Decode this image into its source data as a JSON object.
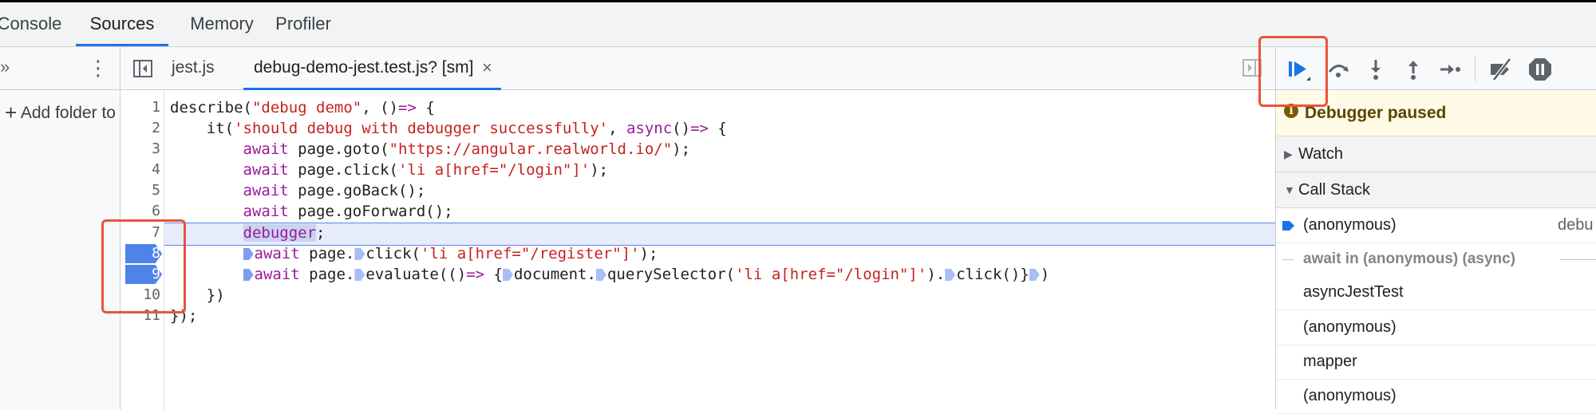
{
  "panel_tabs": [
    "Console",
    "Sources",
    "Memory",
    "Profiler"
  ],
  "navigator": {
    "more_label": "»",
    "menu_label": "⋮",
    "add_folder_label": "Add folder to"
  },
  "files": {
    "tab1": "jest.js",
    "tab2": "debug-demo-jest.test.js? [sm]",
    "close": "×"
  },
  "editor": {
    "line_numbers": [
      "1",
      "2",
      "3",
      "4",
      "5",
      "6",
      "7",
      "8",
      "9",
      "10",
      "11"
    ],
    "paused_line": "7",
    "breakpoint_lines": [
      "8",
      "9"
    ],
    "lines": [
      "describe(\"debug demo\", ()=> {",
      "    it('should debug with debugger successfully', async()=> {",
      "        await page.goto(\"https://angular.realworld.io/\");",
      "        await page.click('li a[href=\"/login\"]');",
      "        await page.goBack();",
      "        await page.goForward();",
      "        debugger;",
      "        await page.click('li a[href=\"/register\"]');",
      "        await page.evaluate(()=> {document.querySelector('li a[href=\"/login\"]').click()})",
      "    })",
      "});"
    ]
  },
  "debugger": {
    "toolbar_icons": [
      "resume-icon",
      "step-over-icon",
      "step-into-icon",
      "step-out-icon",
      "step-icon",
      "deactivate-breakpoints-icon",
      "pause-on-exceptions-icon"
    ],
    "paused_text": "Debugger paused",
    "watch_label": "Watch",
    "call_stack_label": "Call Stack",
    "current_frame": "(anonymous)",
    "current_frame_location": "debu",
    "async_label": "await in (anonymous) (async)",
    "frames": [
      "asyncJestTest",
      "(anonymous)",
      "mapper",
      "(anonymous)"
    ]
  },
  "colors": {
    "accent": "#1a73e8",
    "breakpoint": "#4e84e8",
    "highlight_box": "#e8543c",
    "paused_banner": "#fffbe6"
  }
}
